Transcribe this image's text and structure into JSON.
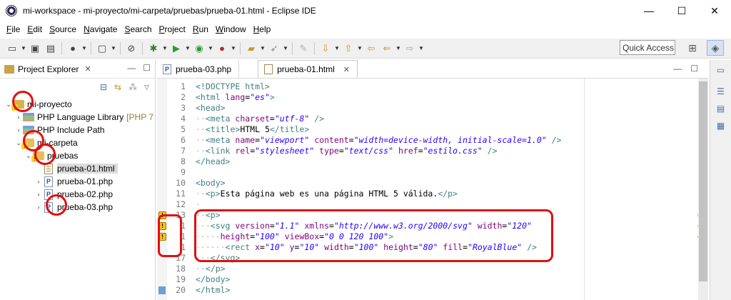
{
  "window": {
    "title": "mi-workspace - mi-proyecto/mi-carpeta/pruebas/prueba-01.html - Eclipse IDE",
    "controls": [
      "—",
      "☐",
      "✕"
    ]
  },
  "menu": [
    "File",
    "Edit",
    "Source",
    "Navigate",
    "Search",
    "Project",
    "Run",
    "Window",
    "Help"
  ],
  "toolbar": {
    "quick_access": "Quick Access"
  },
  "explorer": {
    "tab_label": "Project Explorer",
    "close": "✕",
    "tree": [
      {
        "label": "mi-proyecto",
        "suffix": ""
      },
      {
        "label": "PHP Language Library",
        "suffix": "[PHP 7"
      },
      {
        "label": "PHP Include Path",
        "suffix": ""
      },
      {
        "label": "mi-carpeta",
        "suffix": ""
      },
      {
        "label": "pruebas",
        "suffix": ""
      },
      {
        "label": "prueba-01.html",
        "suffix": ""
      },
      {
        "label": "prueba-01.php",
        "suffix": ""
      },
      {
        "label": "prueba-02.php",
        "suffix": ""
      },
      {
        "label": "prueba-03.php",
        "suffix": ""
      }
    ]
  },
  "editor": {
    "tabs": [
      {
        "label": "prueba-03.php"
      },
      {
        "label": "prueba-01.html"
      }
    ],
    "close": "✕",
    "lines": [
      {
        "n": "1",
        "parts": [
          [
            "tag",
            "<!DOCTYPE html>"
          ]
        ]
      },
      {
        "n": "2",
        "parts": [
          [
            "tag",
            "<html "
          ],
          [
            "attr",
            "lang"
          ],
          [
            "txt",
            "="
          ],
          [
            "val",
            "\"es\""
          ],
          [
            "tag",
            ">"
          ]
        ]
      },
      {
        "n": "3",
        "parts": [
          [
            "tag",
            "<head>"
          ]
        ]
      },
      {
        "n": "4",
        "parts": [
          [
            "ws",
            "··"
          ],
          [
            "tag",
            "<meta "
          ],
          [
            "attr",
            "charset"
          ],
          [
            "txt",
            "="
          ],
          [
            "val",
            "\"utf-8\""
          ],
          [
            "tag",
            " />"
          ]
        ]
      },
      {
        "n": "5",
        "parts": [
          [
            "ws",
            "··"
          ],
          [
            "tag",
            "<title>"
          ],
          [
            "txt",
            "HTML 5"
          ],
          [
            "tag",
            "</title>"
          ]
        ]
      },
      {
        "n": "6",
        "parts": [
          [
            "ws",
            "··"
          ],
          [
            "tag",
            "<meta "
          ],
          [
            "attr",
            "name"
          ],
          [
            "txt",
            "="
          ],
          [
            "val",
            "\"viewport\""
          ],
          [
            "txt",
            " "
          ],
          [
            "attr",
            "content"
          ],
          [
            "txt",
            "="
          ],
          [
            "val",
            "\"width=device-width, initial-scale=1.0\""
          ],
          [
            "tag",
            " />"
          ]
        ]
      },
      {
        "n": "7",
        "parts": [
          [
            "ws",
            "··"
          ],
          [
            "tag",
            "<link "
          ],
          [
            "attr",
            "rel"
          ],
          [
            "txt",
            "="
          ],
          [
            "val",
            "\"stylesheet\""
          ],
          [
            "txt",
            " "
          ],
          [
            "attr",
            "type"
          ],
          [
            "txt",
            "="
          ],
          [
            "val",
            "\"text/css\""
          ],
          [
            "txt",
            " "
          ],
          [
            "attr",
            "href"
          ],
          [
            "txt",
            "="
          ],
          [
            "val",
            "\"estilo.css\""
          ],
          [
            "tag",
            " />"
          ]
        ]
      },
      {
        "n": "8",
        "parts": [
          [
            "tag",
            "</head>"
          ]
        ]
      },
      {
        "n": "9",
        "parts": []
      },
      {
        "n": "10",
        "parts": [
          [
            "tag",
            "<body>"
          ]
        ]
      },
      {
        "n": "11",
        "parts": [
          [
            "ws",
            "··"
          ],
          [
            "tag",
            "<p>"
          ],
          [
            "txt",
            "Esta página web es una página HTML 5 válida."
          ],
          [
            "tag",
            "</p>"
          ]
        ]
      },
      {
        "n": "12",
        "parts": [
          [
            "ws",
            "·"
          ]
        ]
      },
      {
        "n": "13",
        "parts": [
          [
            "ws",
            "··"
          ],
          [
            "tag",
            "<p>"
          ]
        ]
      },
      {
        "n": "14",
        "parts": [
          [
            "ws",
            "···"
          ],
          [
            "tag",
            "<svg "
          ],
          [
            "attr",
            "version"
          ],
          [
            "txt",
            "="
          ],
          [
            "val",
            "\"1.1\""
          ],
          [
            "txt",
            " "
          ],
          [
            "attr",
            "xmlns"
          ],
          [
            "txt",
            "="
          ],
          [
            "val",
            "\"http://www.w3.org/2000/svg\""
          ],
          [
            "txt",
            " "
          ],
          [
            "attr",
            "width"
          ],
          [
            "txt",
            "="
          ],
          [
            "val",
            "\"120\""
          ]
        ]
      },
      {
        "n": "15",
        "parts": [
          [
            "ws",
            "·····"
          ],
          [
            "attr",
            "height"
          ],
          [
            "txt",
            "="
          ],
          [
            "val",
            "\"100\""
          ],
          [
            "txt",
            " "
          ],
          [
            "attr",
            "viewBox"
          ],
          [
            "txt",
            "="
          ],
          [
            "val",
            "\"0 0 120 100\""
          ],
          [
            "tag",
            ">"
          ]
        ]
      },
      {
        "n": "16",
        "parts": [
          [
            "ws",
            "······"
          ],
          [
            "tag",
            "<rect "
          ],
          [
            "attr",
            "x"
          ],
          [
            "txt",
            "="
          ],
          [
            "val",
            "\"10\""
          ],
          [
            "txt",
            " "
          ],
          [
            "attr",
            "y"
          ],
          [
            "txt",
            "="
          ],
          [
            "val",
            "\"10\""
          ],
          [
            "txt",
            " "
          ],
          [
            "attr",
            "width"
          ],
          [
            "txt",
            "="
          ],
          [
            "val",
            "\"100\""
          ],
          [
            "txt",
            " "
          ],
          [
            "attr",
            "height"
          ],
          [
            "txt",
            "="
          ],
          [
            "val",
            "\"80\""
          ],
          [
            "txt",
            " "
          ],
          [
            "attr",
            "fill"
          ],
          [
            "txt",
            "="
          ],
          [
            "val",
            "\"RoyalBlue\""
          ],
          [
            "tag",
            " />"
          ]
        ]
      },
      {
        "n": "17",
        "parts": [
          [
            "ws",
            "···"
          ],
          [
            "tag",
            "</svg>"
          ]
        ]
      },
      {
        "n": "18",
        "parts": [
          [
            "ws",
            "··"
          ],
          [
            "tag",
            "</p>"
          ]
        ]
      },
      {
        "n": "19",
        "parts": [
          [
            "tag",
            "</body>"
          ]
        ]
      },
      {
        "n": "20",
        "parts": [
          [
            "tag",
            "</html>"
          ]
        ]
      }
    ],
    "gutter_labels": {
      "14": "1",
      "15": "1",
      "16": "1"
    }
  },
  "colors": {
    "tag": "#3f7f7f",
    "attr": "#7f007f",
    "value": "#2a00ff",
    "highlight_circle": "#e01010",
    "warning": "#f7c21d"
  }
}
